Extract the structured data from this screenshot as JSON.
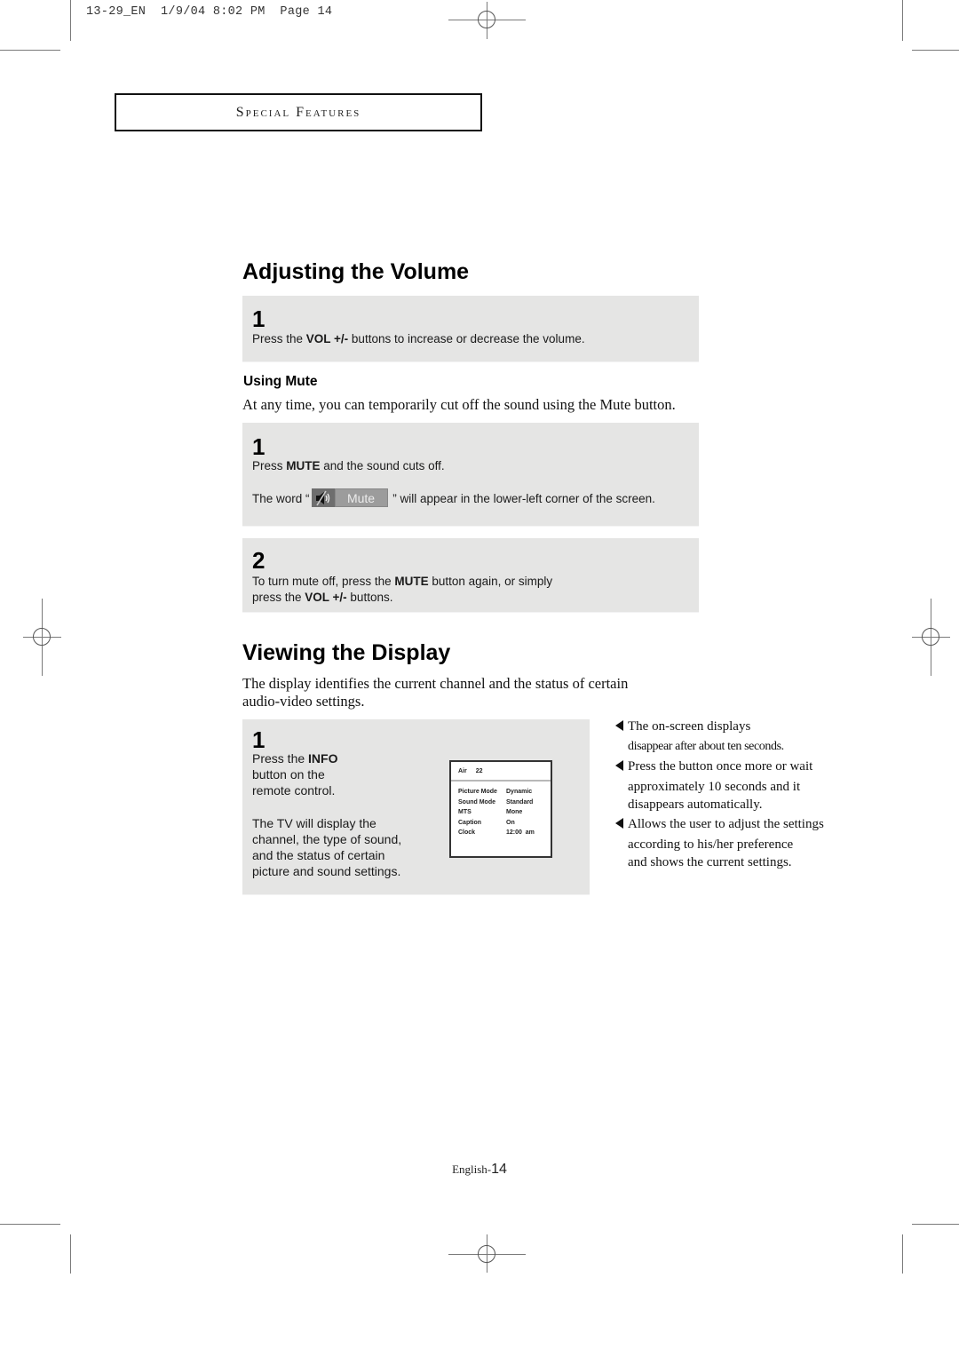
{
  "slug": "13-29_EN  1/9/04 8:02 PM  Page 14",
  "section_title": "Special Features",
  "adjusting_volume": {
    "heading": "Adjusting the Volume",
    "step1": {
      "number": "1",
      "text_pre": "Press the ",
      "text_bold": "VOL +/-",
      "text_post": " buttons to increase or decrease the volume."
    }
  },
  "using_mute": {
    "subheading": "Using Mute",
    "intro": "At any time, you can temporarily cut off the sound using the Mute button.",
    "step1": {
      "number": "1",
      "line1_pre": "Press ",
      "line1_bold": "MUTE",
      "line1_post": " and the sound cuts off.",
      "line2_pre": "The word “",
      "mute_chip_icon": "speaker-muted-icon",
      "mute_chip_label": "Mute",
      "line2_post": " ” will appear in the lower-left corner of the screen."
    },
    "step2": {
      "number": "2",
      "line1_pre": "To turn mute off, press the ",
      "line1_bold": "MUTE",
      "line1_post": " button again, or simply",
      "line2_pre": "press the ",
      "line2_bold": "VOL +/-",
      "line2_post": " buttons."
    }
  },
  "viewing_display": {
    "heading": "Viewing the Display",
    "intro_line1": "The display identifies the current channel and the status of certain",
    "intro_line2": "audio-video settings.",
    "step1": {
      "number": "1",
      "press_pre": "Press the ",
      "press_bold": "INFO",
      "press_line2": "button on the",
      "press_line3": "remote control.",
      "desc_lines": [
        "The TV will display the",
        "channel, the type of sound,",
        "and the status of certain",
        "picture and sound settings."
      ],
      "osd": {
        "source": "Air",
        "channel": "22",
        "rows": [
          {
            "label": "Picture Mode",
            "value": "Dynamic"
          },
          {
            "label": "Sound Mode",
            "value": "Standard"
          },
          {
            "label": "MTS",
            "value": "Mone"
          },
          {
            "label": "Caption",
            "value": "On"
          },
          {
            "label": "Clock",
            "value": "12:00  am"
          }
        ]
      }
    },
    "notes": [
      {
        "lines": [
          "The on-screen displays",
          "disappear after about ten seconds."
        ]
      },
      {
        "lines": [
          "Press the button once more or wait",
          "approximately 10 seconds and it",
          "disappears automatically."
        ]
      },
      {
        "lines": [
          "Allows the user to adjust the settings",
          "according to his/her preference",
          "and shows the current settings."
        ]
      }
    ]
  },
  "footer": {
    "language": "English-",
    "page_number": "14"
  }
}
